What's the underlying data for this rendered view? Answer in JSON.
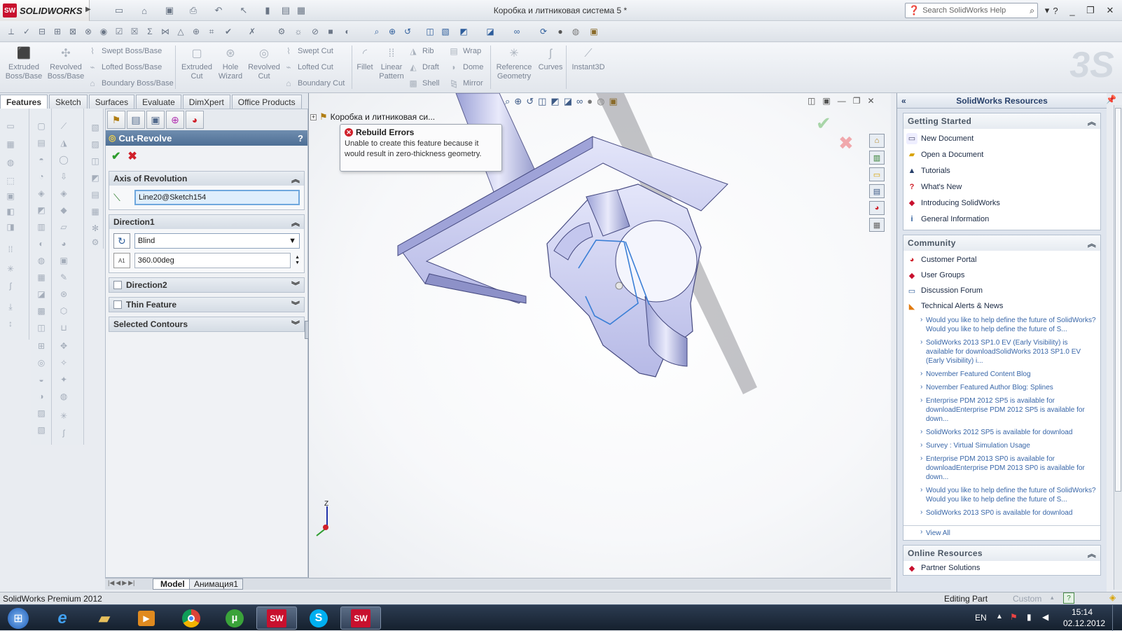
{
  "app": {
    "name": "SOLIDWORKS",
    "badge": "SW",
    "document_title": "Коробка и литниковая система 5 *"
  },
  "help_search": {
    "placeholder": "Search SolidWorks Help"
  },
  "command_manager": {
    "large": [
      {
        "label": "Extruded Boss/Base"
      },
      {
        "label": "Revolved Boss/Base"
      },
      {
        "label": "Extruded Cut"
      },
      {
        "label": "Hole Wizard"
      },
      {
        "label": "Revolved Cut"
      },
      {
        "label": "Fillet"
      },
      {
        "label": "Linear Pattern"
      },
      {
        "label": "Reference Geometry"
      },
      {
        "label": "Curves"
      },
      {
        "label": "Instant3D"
      }
    ],
    "small_col1": [
      "Swept Boss/Base",
      "Lofted Boss/Base",
      "Boundary Boss/Base"
    ],
    "small_col2": [
      "Swept Cut",
      "Lofted Cut",
      "Boundary Cut"
    ],
    "small_col3": [
      "Rib",
      "Draft",
      "Shell"
    ],
    "small_col4": [
      "Wrap",
      "Dome",
      "Mirror"
    ]
  },
  "tabs": [
    "Features",
    "Sketch",
    "Surfaces",
    "Evaluate",
    "DimXpert",
    "Office Products"
  ],
  "property_manager": {
    "title": "Cut-Revolve",
    "help": "?",
    "axis_group": {
      "label": "Axis of Revolution",
      "value": "Line20@Sketch154"
    },
    "direction1": {
      "label": "Direction1",
      "end_condition": "Blind",
      "angle": "360.00deg",
      "angle_prefix": "A1"
    },
    "direction2": {
      "label": "Direction2"
    },
    "thin_feature": {
      "label": "Thin Feature"
    },
    "selected_contours": {
      "label": "Selected Contours"
    }
  },
  "viewport": {
    "tree_root": "Коробка и литниковая си...",
    "error_title": "Rebuild Errors",
    "error_text": "Unable to create this feature because it would result in zero-thickness geometry.",
    "triad": {
      "z": "Z"
    }
  },
  "bottom_tabs": [
    "Model",
    "Анимация1"
  ],
  "resources": {
    "title": "SolidWorks Resources",
    "getting_started": {
      "label": "Getting Started",
      "items": [
        "New Document",
        "Open a Document",
        "Tutorials",
        "What's New",
        "Introducing SolidWorks",
        "General Information"
      ]
    },
    "community": {
      "label": "Community",
      "items": [
        "Customer Portal",
        "User Groups",
        "Discussion Forum",
        "Technical Alerts & News"
      ]
    },
    "news": [
      "Would you like to help define the future of SolidWorks?Would you like to help define the future of S...",
      "SolidWorks 2013 SP1.0 EV (Early Visibility) is available for downloadSolidWorks 2013 SP1.0 EV (Early Visibility) i...",
      "November Featured Content Blog",
      "November Featured Author Blog: Splines",
      "Enterprise PDM 2012 SP5 is available for downloadEnterprise PDM 2012 SP5 is available for down...",
      "SolidWorks 2012 SP5 is available for download",
      "Survey : Virtual Simulation Usage",
      "Enterprise PDM 2013 SP0 is available for downloadEnterprise PDM 2013 SP0 is available for down...",
      "Would you like to help define the future of SolidWorks?Would you like to help define the future of S...",
      "SolidWorks 2013 SP0 is available for download"
    ],
    "view_all": "View All",
    "online": {
      "label": "Online Resources",
      "items": [
        "Partner Solutions"
      ]
    }
  },
  "status": {
    "left": "SolidWorks Premium 2012",
    "mode": "Editing Part",
    "units": "Custom"
  },
  "taskbar": {
    "lang": "EN",
    "time": "15:14",
    "date": "02.12.2012"
  },
  "colors": {
    "accent": "#4e6f95",
    "error": "#d0202a",
    "ok": "#2e9d2e",
    "part": "#c9cbf0"
  }
}
